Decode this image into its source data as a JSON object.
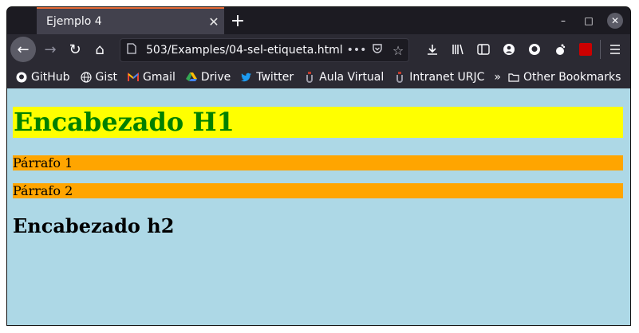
{
  "tab": {
    "title": "Ejemplo 4",
    "close": "✕",
    "new_tab": "+"
  },
  "window_controls": {
    "minimize": "–",
    "maximize": "□",
    "close": "✕"
  },
  "nav": {
    "back": "←",
    "forward": "→",
    "reload": "↻",
    "home": "⌂",
    "url": "503/Examples/04-sel-etiqueta.html",
    "url_more": "•••"
  },
  "bookmarks": [
    {
      "label": "GitHub",
      "icon": "github-icon"
    },
    {
      "label": "Gist",
      "icon": "globe-icon"
    },
    {
      "label": "Gmail",
      "icon": "gmail-icon"
    },
    {
      "label": "Drive",
      "icon": "drive-icon"
    },
    {
      "label": "Twitter",
      "icon": "twitter-icon"
    },
    {
      "label": "Aula Virtual",
      "icon": "urjc-icon"
    },
    {
      "label": "Intranet URJC",
      "icon": "urjc-icon"
    }
  ],
  "bookmarks_overflow": "»",
  "other_bookmarks": "Other Bookmarks",
  "page": {
    "h1": "Encabezado H1",
    "p1": "Párrafo 1",
    "p2": "Párrafo 2",
    "h2": "Encabezado h2"
  },
  "colors": {
    "background": "#add8e6",
    "h1_background": "#ffff00",
    "h1_text": "#008000",
    "paragraph_background": "#ffa500",
    "tab_accent": "#e66a36"
  }
}
